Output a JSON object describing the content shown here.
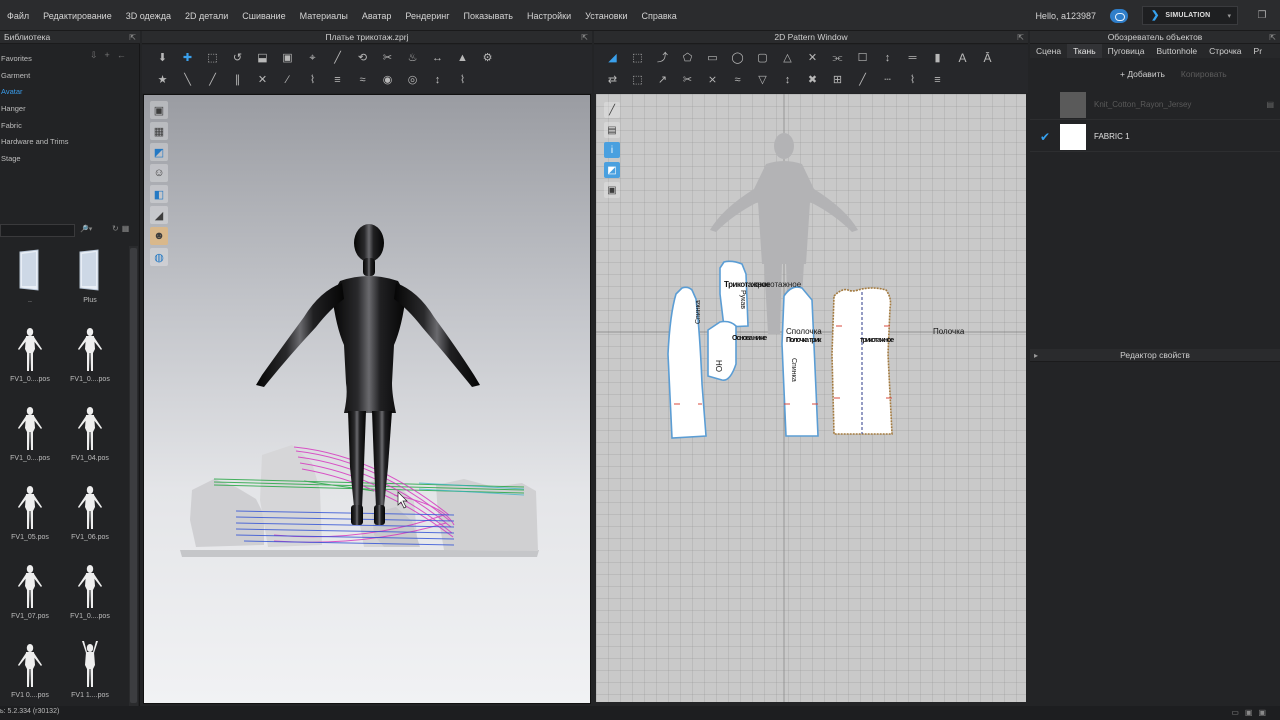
{
  "menu": [
    "Файл",
    "Редактирование",
    "3D одежда",
    "2D детали",
    "Сшивание",
    "Материалы",
    "Аватар",
    "Рендеринг",
    "Показывать",
    "Настройки",
    "Установки",
    "Справка"
  ],
  "header": {
    "greeting": "Hello, ",
    "username": "a123987",
    "sim_label": "SIMULATION",
    "accent": "#36a2ef"
  },
  "library": {
    "title": "Библиотека",
    "tree": [
      {
        "label": "Favorites",
        "active": false
      },
      {
        "label": "Garment",
        "active": false
      },
      {
        "label": "Avatar",
        "active": true
      },
      {
        "label": "Hanger",
        "active": false
      },
      {
        "label": "Fabric",
        "active": false
      },
      {
        "label": "Hardware and Trims",
        "active": false
      },
      {
        "label": "Stage",
        "active": false
      }
    ],
    "items": [
      {
        "label": "..",
        "kind": "folder"
      },
      {
        "label": "Plus",
        "kind": "folder"
      },
      {
        "label": "FV1_0....pos",
        "kind": "pose"
      },
      {
        "label": "FV1_0....pos",
        "kind": "pose"
      },
      {
        "label": "FV1_0....pos",
        "kind": "pose"
      },
      {
        "label": "FV1_04.pos",
        "kind": "pose"
      },
      {
        "label": "FV1_05.pos",
        "kind": "pose"
      },
      {
        "label": "FV1_06.pos",
        "kind": "pose"
      },
      {
        "label": "FV1_07.pos",
        "kind": "pose"
      },
      {
        "label": "FV1_0....pos",
        "kind": "pose"
      },
      {
        "label": "FV1 0....pos",
        "kind": "pose"
      },
      {
        "label": "FV1 1....pos",
        "kind": "pose"
      }
    ]
  },
  "view3d": {
    "title": "Платье трикотаж.zprj"
  },
  "view2d": {
    "title": "2D Pattern Window"
  },
  "objects": {
    "title": "Обозреватель объектов",
    "tabs": [
      {
        "label": "Сцена",
        "active": false
      },
      {
        "label": "Ткань",
        "active": true
      },
      {
        "label": "Пуговица",
        "active": false
      },
      {
        "label": "Buttonhole",
        "active": false
      },
      {
        "label": "Строчка",
        "active": false
      },
      {
        "label": "Pr",
        "active": false
      }
    ],
    "add_label": "+ Добавить",
    "copy_label": "Копировать",
    "fabrics": [
      {
        "name": "Knit_Cotton_Rayon_Jersey",
        "swatch": "#5a5a5a",
        "checked": false,
        "dim": true
      },
      {
        "name": "FABRIC 1",
        "swatch": "#ffffff",
        "checked": true,
        "dim": false
      }
    ]
  },
  "properties": {
    "title": "Редактор свойств"
  },
  "status": {
    "version": "ь: 5.2.334 (r30132)"
  }
}
